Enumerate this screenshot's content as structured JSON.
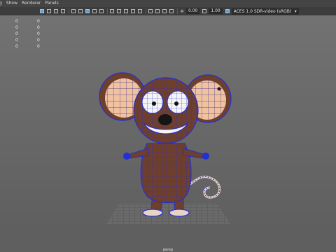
{
  "menu": {
    "items": [
      "g",
      "Show",
      "Renderer",
      "Panels"
    ]
  },
  "toolbar": {
    "exposure_value": "0.00",
    "gamma_value": "1.00",
    "color_transform": "ACES 1.0 SDR-video (sRGB)"
  },
  "hud": {
    "rows": [
      {
        "a": "0",
        "b": "0"
      },
      {
        "a": "0",
        "b": "0"
      },
      {
        "a": "0",
        "b": "0"
      },
      {
        "a": "0",
        "b": "0"
      },
      {
        "a": "0",
        "b": "0"
      }
    ]
  },
  "viewport": {
    "camera_label": "persp"
  },
  "colors": {
    "menu_bg": "#444444",
    "viewport_bg": "#6b6b6b",
    "wire": "#1f2bd6",
    "fur": "#6e3f2c",
    "ear_inner": "#f2c3a2"
  },
  "icons": [
    "select-icon",
    "lasso-icon",
    "paint-icon",
    "move-icon",
    "camera-icon",
    "grid-icon",
    "wireframe-icon",
    "shaded-icon",
    "texture-icon",
    "light-icon",
    "shadow-icon",
    "isolate-icon",
    "xray-icon",
    "gear-icon",
    "color-management-icon"
  ]
}
